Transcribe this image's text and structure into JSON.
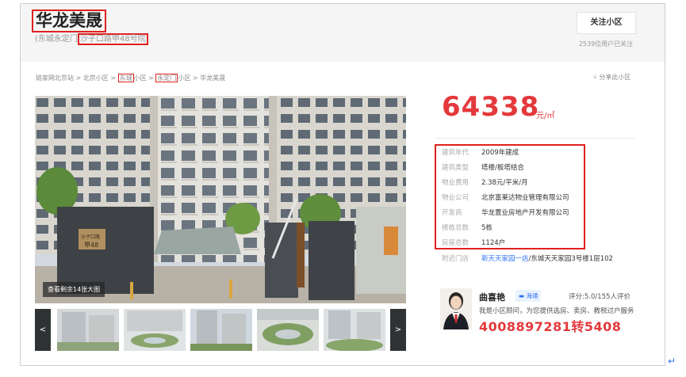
{
  "community": {
    "name": "华龙美晟",
    "district_prefix": "(东城永定门",
    "address": "沙子口路甲48号院",
    "follow_label": "关注小区",
    "follow_count": "2539位用户已关注"
  },
  "breadcrumb": {
    "part1": "链家网北京站 > 北京小区 > ",
    "district": "东城",
    "part2": "小区 > ",
    "area": "永定门",
    "part3": "小区 > 华龙美晟",
    "share_label": "分享此小区"
  },
  "gallery": {
    "more_label": "查看剩余14张大图",
    "prev_label": "<",
    "next_label": ">",
    "gate_sign": "沙子口路 甲48"
  },
  "price": {
    "value": "64338",
    "unit": "元/㎡"
  },
  "info": [
    {
      "label": "建筑年代",
      "value": "2009年建成"
    },
    {
      "label": "建筑类型",
      "value": "塔楼/板塔结合"
    },
    {
      "label": "物业费用",
      "value": "2.38元/平米/月"
    },
    {
      "label": "物业公司",
      "value": "北京富莱达物业管理有限公司"
    },
    {
      "label": "开发商",
      "value": "华龙置业房地产开发有限公司"
    },
    {
      "label": "楼栋总数",
      "value": "5栋"
    },
    {
      "label": "房屋总数",
      "value": "1124户"
    }
  ],
  "nearby": {
    "label": "附近门店",
    "store": "新天天家园一店",
    "address": "/东城天天家园3号楼1层102"
  },
  "agent": {
    "name": "曲喜艳",
    "chat_label": "海通",
    "rating": "评分:5.0/155人评价",
    "desc": "我是小区顾问，为您提供选房、卖房、教税过户服务",
    "phone": "4008897281转5408"
  },
  "colors": {
    "accent_red": "#e4393c",
    "highlight_box": "#e02020",
    "link_blue": "#3072f6"
  }
}
